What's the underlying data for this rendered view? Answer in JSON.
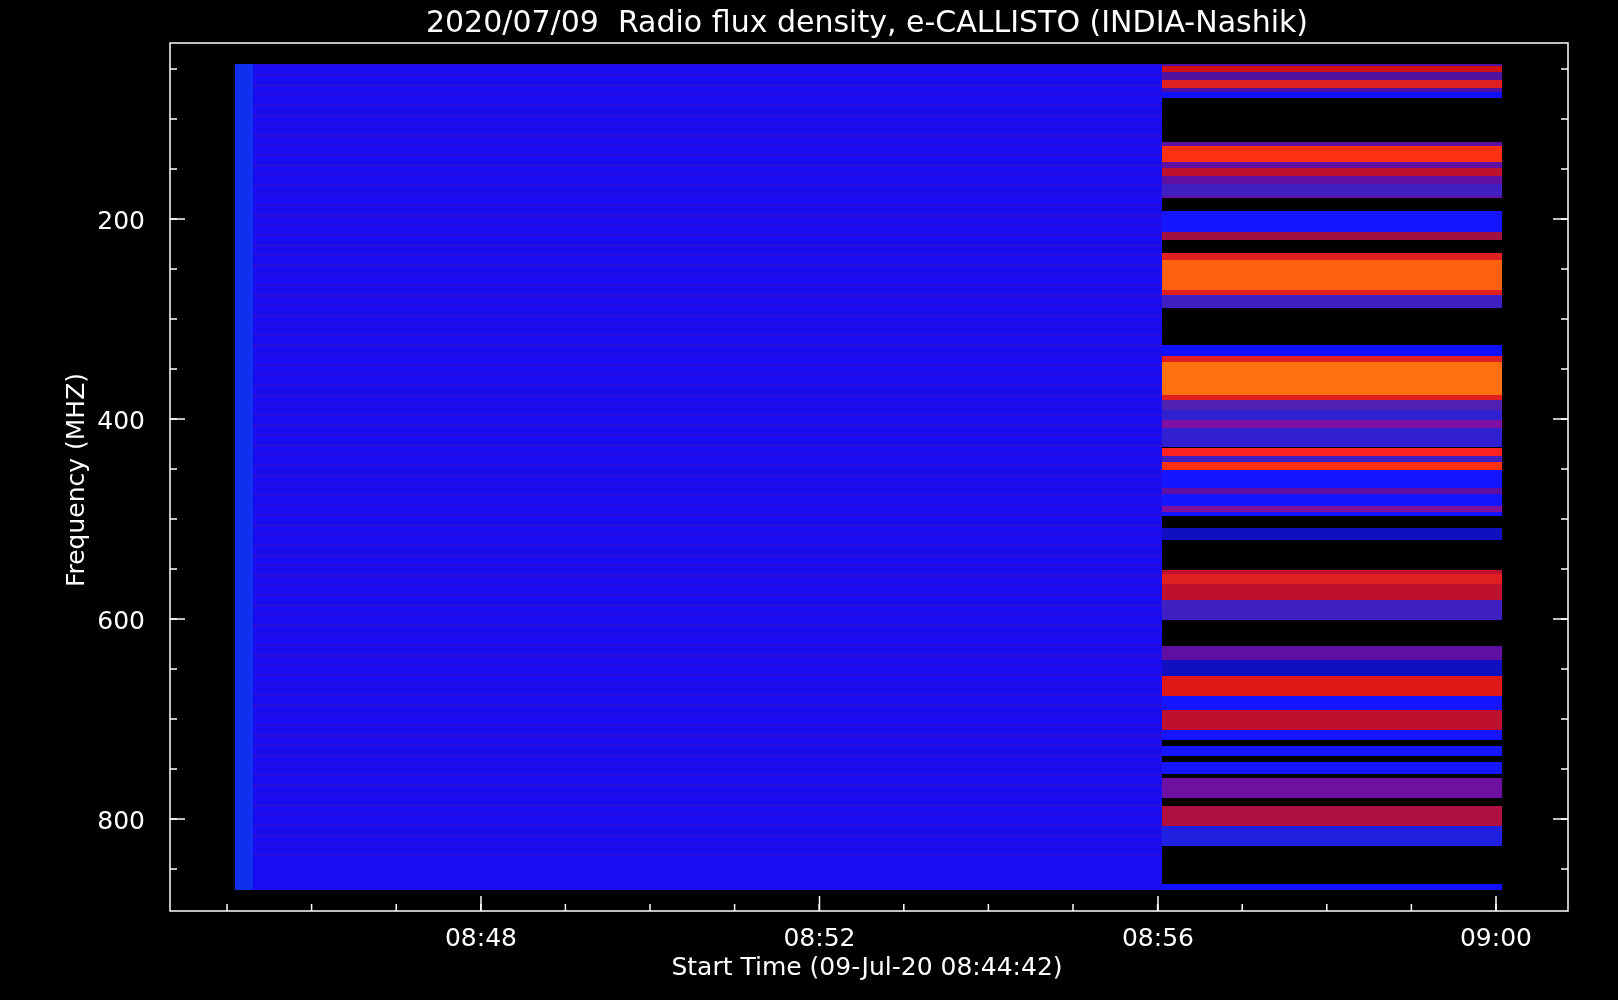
{
  "chart": {
    "title": "2020/07/09  Radio flux density, e-CALLISTO (INDIA-Nashik)",
    "ylabel": "Frequency (MHZ)",
    "xlabel": "Start Time (09-Jul-20 08:44:42)",
    "yticks": [
      "200",
      "400",
      "600",
      "800"
    ],
    "xticks": [
      "08:48",
      "08:52",
      "08:56",
      "09:00"
    ]
  }
}
